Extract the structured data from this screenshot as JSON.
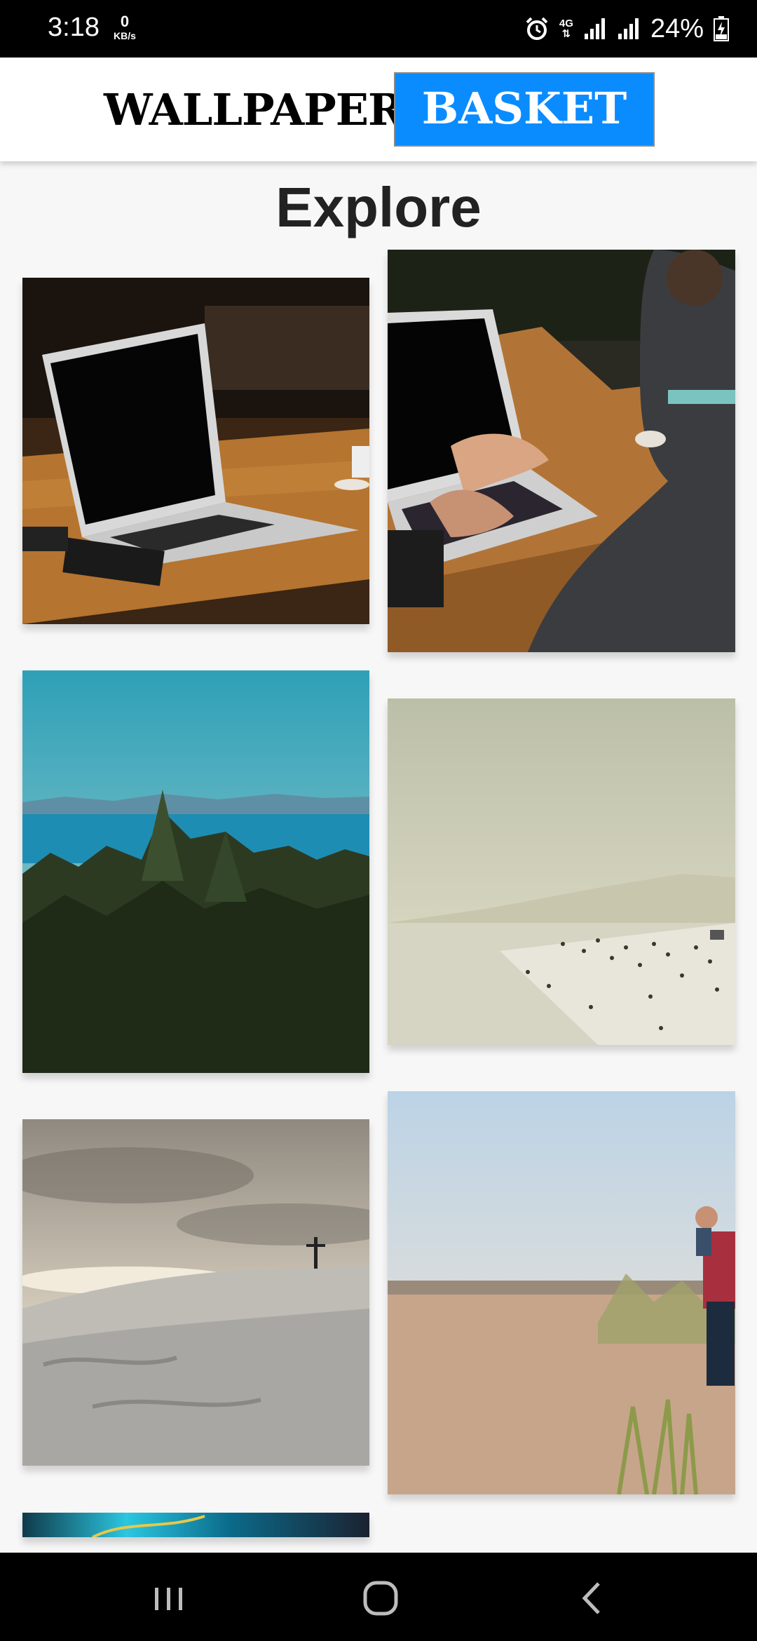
{
  "status_bar": {
    "time": "3:18",
    "net_speed_value": "0",
    "net_speed_unit": "KB/s",
    "network_type": "4G",
    "battery": "24%",
    "icons": [
      "alarm-icon",
      "signal-icon",
      "signal-icon",
      "battery-charging-icon"
    ]
  },
  "app_bar": {
    "logo_left": "WALLPAPER",
    "logo_right": "BASKET",
    "logo_right_color": "#0a8cff"
  },
  "page": {
    "title": "Explore"
  },
  "gallery": {
    "items": [
      {
        "subject": "laptop on wooden table"
      },
      {
        "subject": "man typing on laptop"
      },
      {
        "subject": "forest and sea"
      },
      {
        "subject": "hazy beach with people"
      },
      {
        "subject": "snowy hill with cross"
      },
      {
        "subject": "beach with father and child"
      },
      {
        "subject": "partial image"
      }
    ]
  },
  "nav_bar": {
    "icons": [
      "recents-icon",
      "home-icon",
      "back-icon"
    ]
  }
}
